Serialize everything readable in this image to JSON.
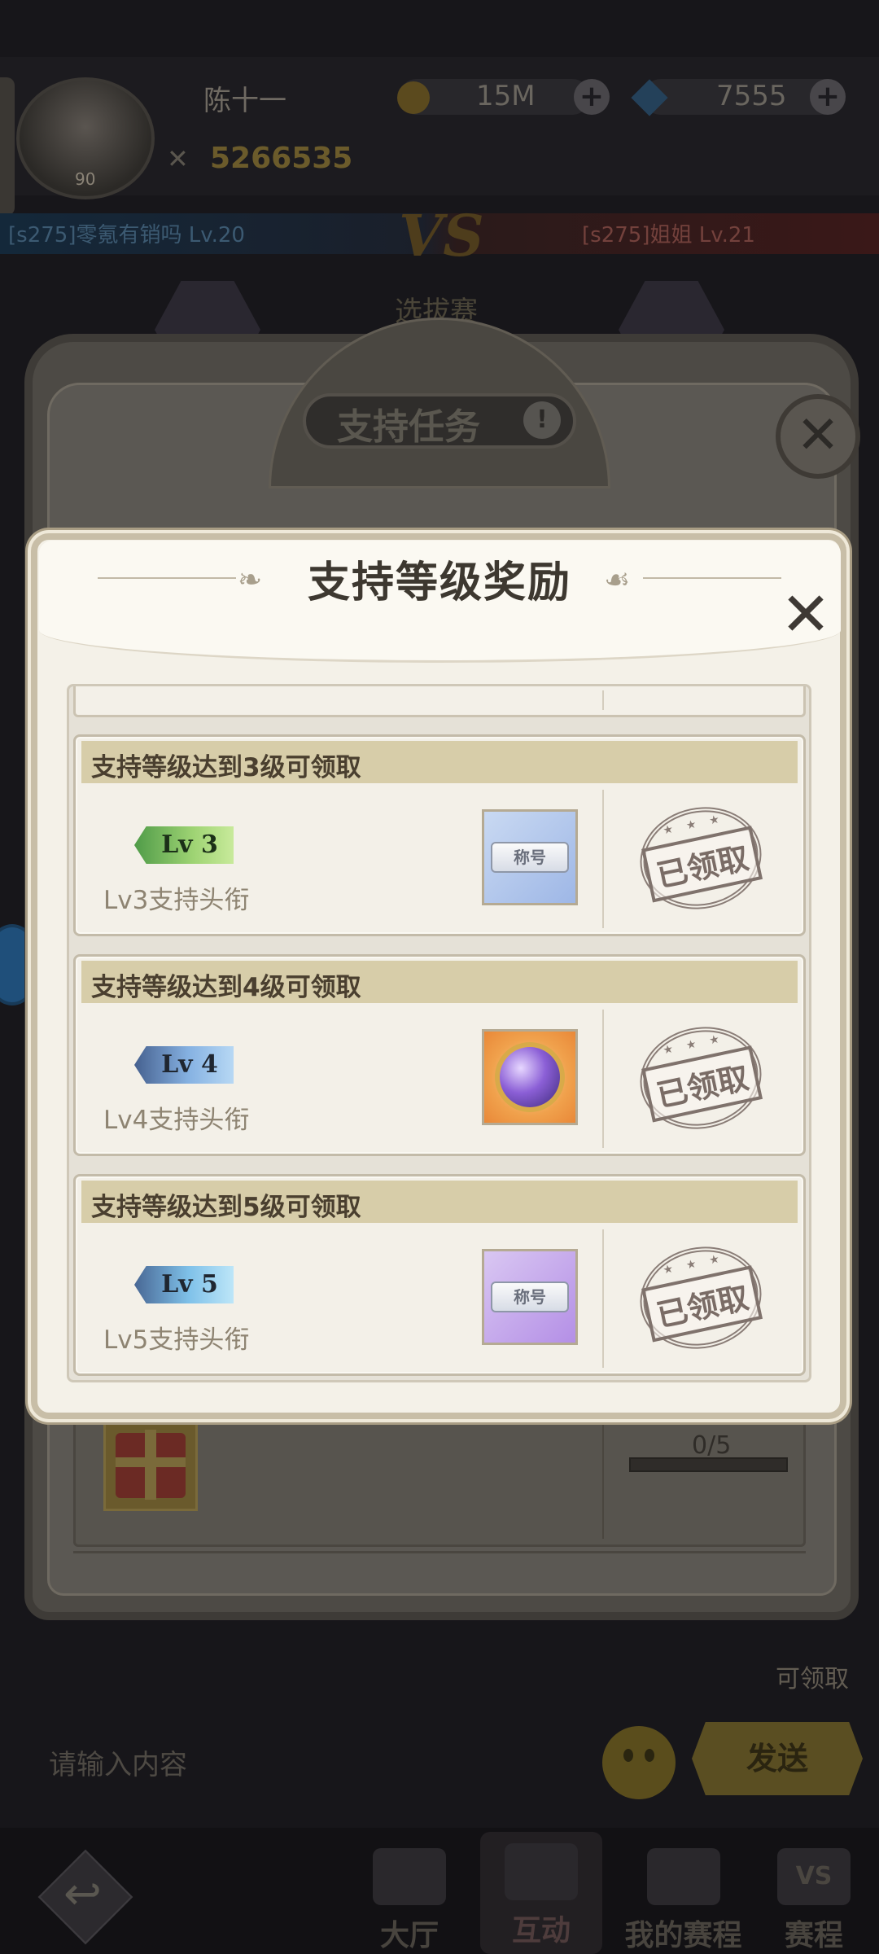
{
  "background": {
    "player": {
      "name": "陈十一",
      "level": "90",
      "power": "5266535"
    },
    "resources": {
      "gold": "15M",
      "gems": "7555"
    },
    "versus": {
      "left_team": "[s275]零氪有销吗 Lv.20",
      "right_team": "[s275]姐姐 Lv.21",
      "vs_label": "VS",
      "stage_title": "选拔赛"
    },
    "claimable_label": "可领取",
    "chat": {
      "placeholder": "请输入内容",
      "send_label": "发送"
    },
    "nav": {
      "lobby": "大厅",
      "interact": "互动",
      "my_schedule": "我的赛程",
      "schedule": "赛程",
      "schedule_icon_text": "VS"
    }
  },
  "support_panel": {
    "title": "支持任务",
    "info_icon": "!",
    "close_icon": "close-icon",
    "task_progress": "0/5"
  },
  "modal": {
    "title": "支持等级奖励",
    "close_icon": "close-icon",
    "rewards": [
      {
        "condition": "支持等级达到3级可领取",
        "badge": "Lv 3",
        "reward_name": "Lv3支持头衔",
        "item_label": "称号",
        "status": "已领取",
        "badge_color": "#7fc265"
      },
      {
        "condition": "支持等级达到4级可领取",
        "badge": "Lv 4",
        "reward_name": "Lv4支持头衔",
        "item_label": "",
        "status": "已领取",
        "badge_color": "#6f9fd6"
      },
      {
        "condition": "支持等级达到5级可领取",
        "badge": "Lv 5",
        "reward_name": "Lv5支持头衔",
        "item_label": "称号",
        "status": "已领取",
        "badge_color": "#6fb6e0"
      }
    ]
  },
  "colors": {
    "modal_bg": "#f4f1e8",
    "card_header": "#d7cda9",
    "stamp": "#7f726c"
  }
}
